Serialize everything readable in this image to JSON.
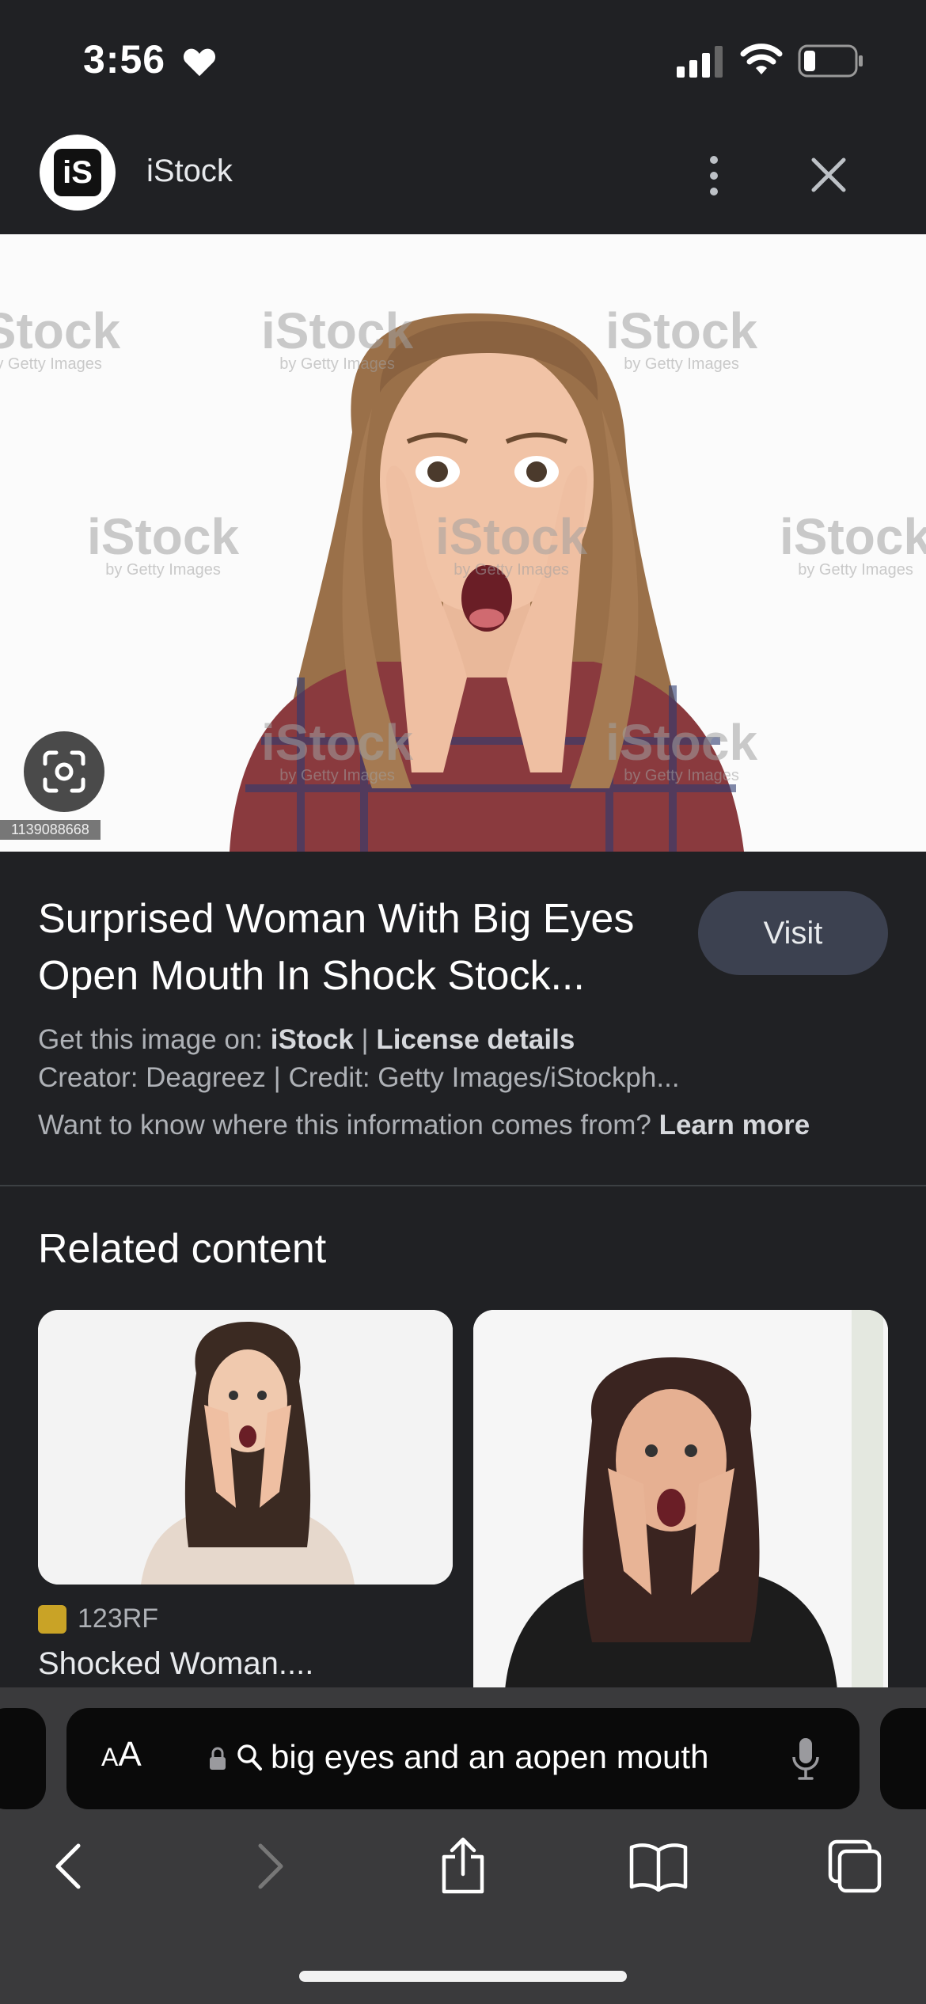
{
  "status_bar": {
    "time": "3:56",
    "icons": [
      "heart-icon",
      "cellular-signal-icon",
      "wifi-icon",
      "battery-icon"
    ]
  },
  "header": {
    "logo_text": "iS",
    "site_name": "iStock",
    "icons": [
      "more-vertical-icon",
      "close-icon"
    ]
  },
  "image": {
    "watermark_text": "iStock",
    "watermark_sub": "by Getty Images",
    "image_id": "1139088668",
    "lens_icon": "lens-search-icon"
  },
  "info": {
    "title": "Surprised Woman With Big Eyes Open Mouth In Shock Stock...",
    "visit_label": "Visit",
    "get_image_prefix": "Get this image on: ",
    "get_image_source": "iStock",
    "separator": " | ",
    "license_label": "License details",
    "creator_line": "Creator: Deagreez | Credit: Getty Images/iStockph...",
    "question": "Want to know where this information comes from? ",
    "learn_more": "Learn more"
  },
  "related": {
    "heading": "Related content",
    "items": [
      {
        "source": "123RF",
        "title": "Shocked Woman...."
      },
      {
        "source": "",
        "title": ""
      }
    ]
  },
  "browser": {
    "aa_label": "A",
    "aa_label_big": "A",
    "address_text": "big eyes and an aopen mouth",
    "nav_icons": [
      "back-icon",
      "forward-icon",
      "share-icon",
      "bookmarks-icon",
      "tabs-icon"
    ]
  },
  "colors": {
    "background": "#202124",
    "visit_button": "#3c4150",
    "toolbar": "#3a3a3c"
  }
}
